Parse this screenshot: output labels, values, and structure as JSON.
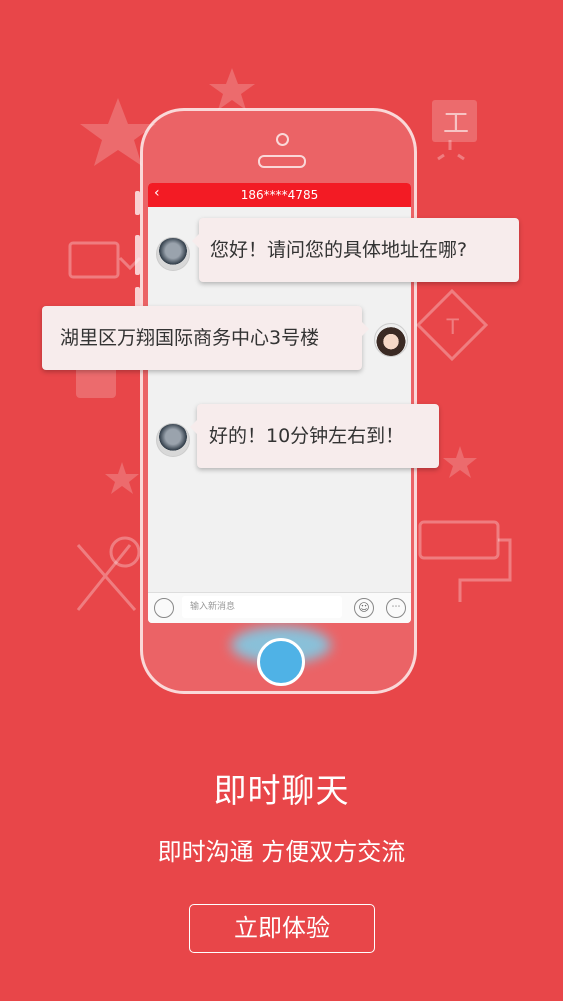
{
  "chat": {
    "contact_title": "186****4785",
    "back_icon": "chevron-left-icon",
    "messages": [
      {
        "side": "left",
        "text": "您好！请问您的具体地址在哪?"
      },
      {
        "side": "right",
        "text": "湖里区万翔国际商务中心3号楼"
      },
      {
        "side": "left",
        "text": "好的！10分钟左右到！"
      }
    ],
    "input_placeholder": "输入新消息",
    "mic_icon": "microphone-icon",
    "emoji_icon": "smiley-icon",
    "more_icon": "more-icon"
  },
  "onboarding": {
    "heading": "即时聊天",
    "subheading": "即时沟通 方便双方交流",
    "cta_label": "立即体验"
  },
  "colors": {
    "background": "#e84649",
    "topbar": "#f31b24",
    "home_button": "#4fb2e6"
  }
}
